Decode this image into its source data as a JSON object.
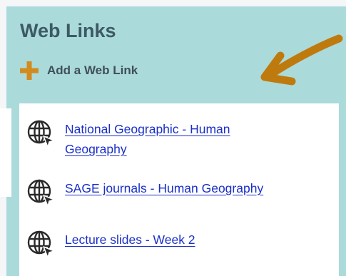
{
  "header": {
    "title": "Web Links"
  },
  "add_link": {
    "label": "Add a Web Link"
  },
  "links": [
    {
      "label": "National Geographic - Human Geography"
    },
    {
      "label": "SAGE journals - Human Geography"
    },
    {
      "label": "Lecture slides - Week 2"
    }
  ],
  "colors": {
    "panel": "#abdadb",
    "title": "#3d5a64",
    "plus": "#d38b1d",
    "arrow": "#bf7a0e",
    "link": "#1a2fc8"
  },
  "icons": {
    "add": "plus-icon",
    "link": "globe-cursor-icon",
    "annotation": "arrow-icon"
  }
}
